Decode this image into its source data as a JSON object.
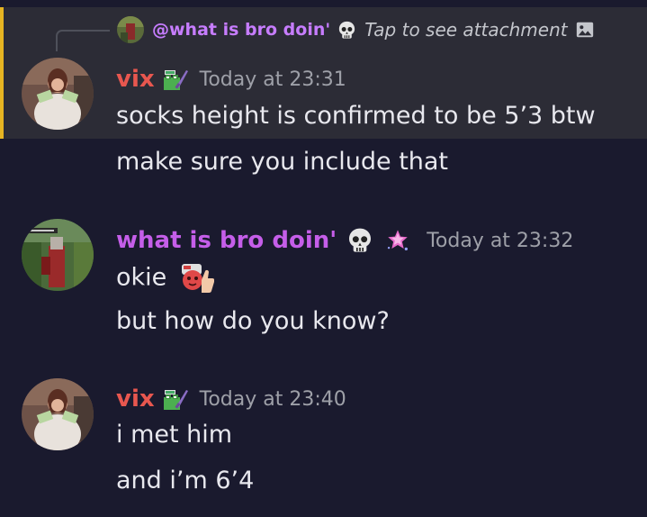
{
  "reply": {
    "author": "@what is bro doin'",
    "preview_text": "Tap to see attachment",
    "icons": [
      "skull-emoji",
      "image-icon"
    ]
  },
  "messages": [
    {
      "author": "vix",
      "author_color": "#e8574f",
      "badge": "pepe-sword-badge",
      "timestamp": "Today at 23:31",
      "lines": [
        "socks height is confirmed to be 5’3 btw",
        "make sure you include that"
      ]
    },
    {
      "author": "what is bro doin'",
      "author_color": "#c55ee9",
      "badges": [
        "skull-emoji",
        "sparkle-star-badge"
      ],
      "timestamp": "Today at 23:32",
      "lines": [
        "okie",
        "but how do you know?"
      ]
    },
    {
      "author": "vix",
      "author_color": "#e8574f",
      "badge": "pepe-sword-badge",
      "timestamp": "Today at 23:40",
      "lines": [
        "i met him",
        "and i’m 6’4"
      ]
    }
  ],
  "colors": {
    "background": "#1a1a2e",
    "highlight": "#2c2c36",
    "highlight_bar": "#e6b422",
    "timestamp": "#9ea0a8",
    "text": "#e8e8ee"
  }
}
